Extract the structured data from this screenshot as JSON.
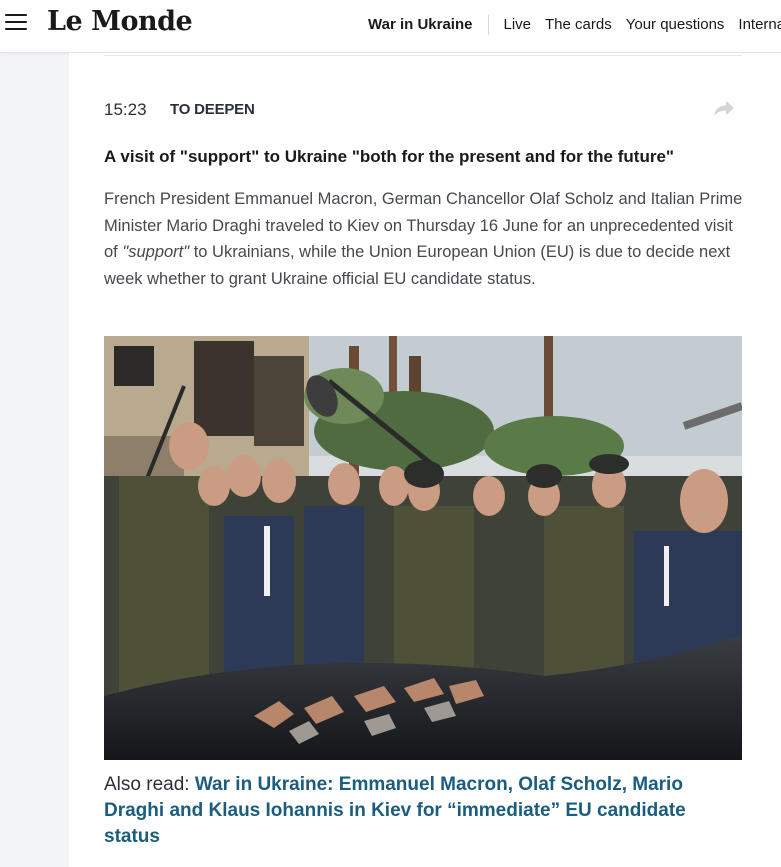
{
  "header": {
    "logo": "Le Monde",
    "nav": [
      {
        "label": "War in Ukraine",
        "strong": true
      },
      {
        "label": "Live"
      },
      {
        "label": "The cards"
      },
      {
        "label": "Your questions"
      },
      {
        "label": "Internatio"
      }
    ]
  },
  "post": {
    "time": "15:23",
    "tag": "TO DEEPEN",
    "headline": "A visit of \"support\" to Ukraine \"both for the present and for the future\"",
    "body_before": "French President Emmanuel Macron, German Chancellor Olaf Scholz and Italian Prime Minister Mario Draghi traveled to Kiev on Thursday 16 June for an unprecedented visit of ",
    "body_em": "\"support\"",
    "body_after": " to Ukrainians, while the Union European Union (EU) is due to decide next week whether to grant Ukraine official EU candidate status.",
    "also_label": "Also read: ",
    "also_link": "War in Ukraine: Emmanuel Macron, Olaf Scholz, Mario Draghi and Klaus Iohannis in Kiev for “immediate” EU candidate status"
  },
  "icons": {
    "menu": "hamburger-icon",
    "share": "share-arrow-icon"
  },
  "colors": {
    "link": "#1a5d7e",
    "text": "#2a303b",
    "background": "#f3f4f6"
  }
}
